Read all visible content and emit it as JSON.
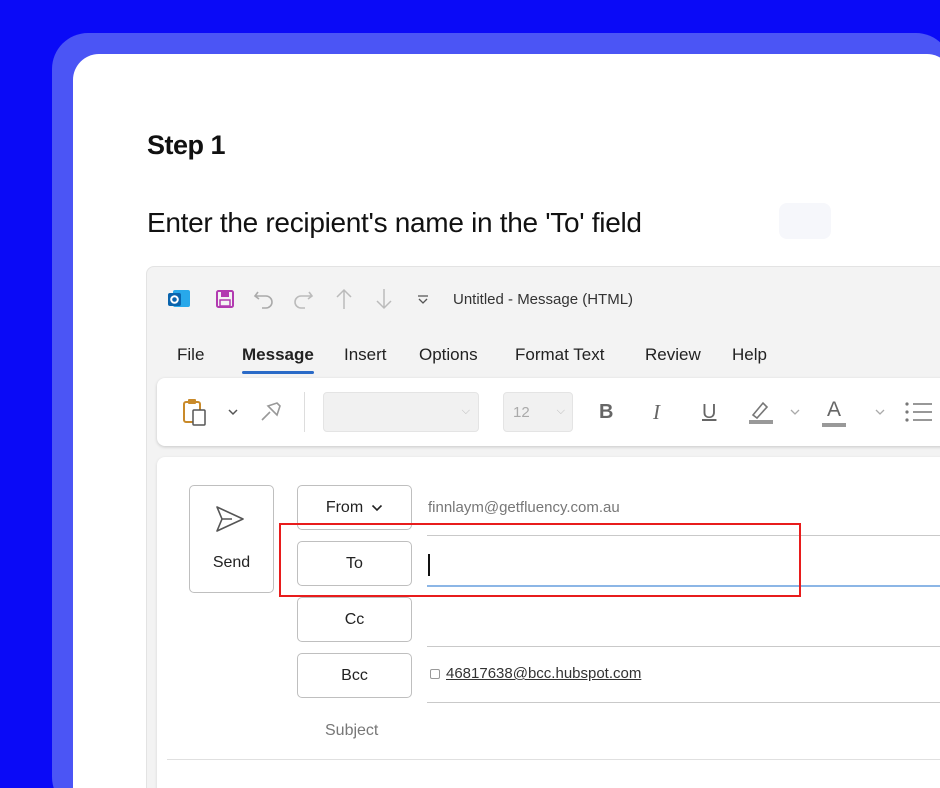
{
  "tutorial": {
    "step": "Step 1",
    "instruction": "Enter the recipient's name in the 'To' field"
  },
  "window": {
    "title": "Untitled  -  Message (HTML)"
  },
  "menu": {
    "items": [
      "File",
      "Message",
      "Insert",
      "Options",
      "Format Text",
      "Review",
      "Help"
    ],
    "active": "Message"
  },
  "ribbon": {
    "font_size": "12",
    "bold": "B",
    "italic": "I",
    "underline": "U",
    "font_color": "A"
  },
  "compose": {
    "send_label": "Send",
    "from_label": "From",
    "from_value": "finnlaym@getfluency.com.au",
    "to_label": "To",
    "to_value": "",
    "cc_label": "Cc",
    "bcc_label": "Bcc",
    "bcc_value": "46817638@bcc.hubspot.com",
    "subject_label": "Subject"
  },
  "colors": {
    "background": "#0a0af7",
    "highlight": "#e81c1c",
    "accent": "#2a6ac7"
  },
  "icons": [
    "outlook-icon",
    "save-icon",
    "undo-icon",
    "redo-icon",
    "arrow-up-icon",
    "arrow-down-icon",
    "customize-toolbar-icon",
    "paste-icon",
    "format-painter-icon",
    "highlight-icon",
    "bullets-icon",
    "send-icon",
    "chevron-down-icon"
  ]
}
